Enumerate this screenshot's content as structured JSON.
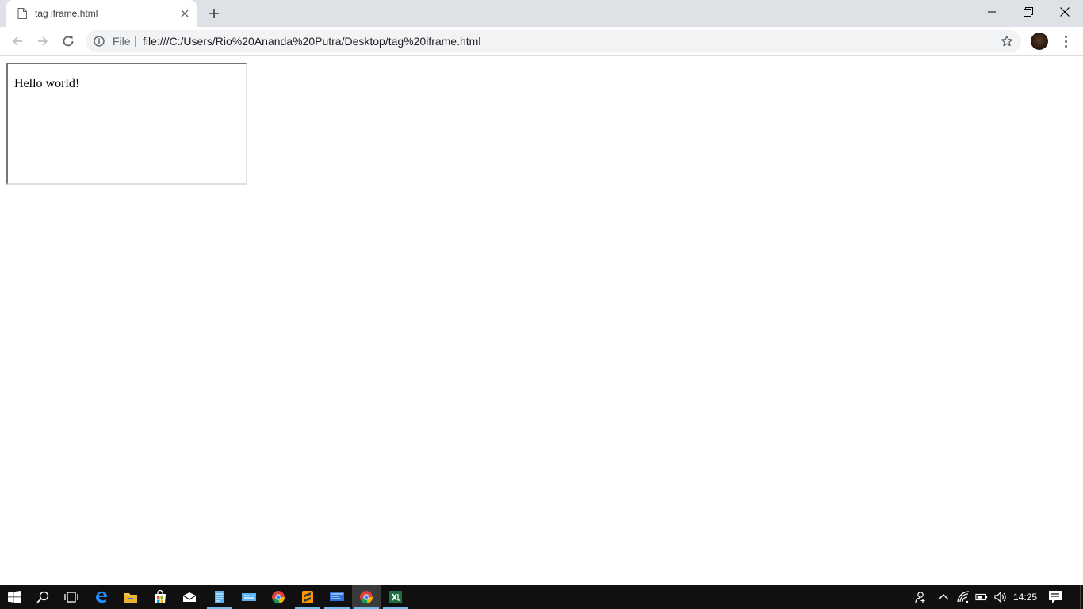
{
  "browser": {
    "tab": {
      "title": "tag iframe.html"
    },
    "omnibox": {
      "scheme_label": "File",
      "url": "file:///C:/Users/Rio%20Ananda%20Putra/Desktop/tag%20iframe.html"
    }
  },
  "page": {
    "iframe_text": "Hello world!"
  },
  "taskbar": {
    "apps": [
      "start-icon",
      "search-icon",
      "task-view-icon",
      "edge-icon",
      "file-explorer-icon",
      "store-icon",
      "mail-icon",
      "notepad-icon",
      "keyboard-icon",
      "chrome-icon",
      "sublime-text-icon",
      "app-icon",
      "chrome-icon",
      "excel-icon"
    ],
    "clock": "14:25"
  },
  "colors": {
    "tabstrip_bg": "#dee1e6",
    "omnibox_bg": "#f1f3f4",
    "taskbar_bg": "#101010",
    "taskbar_active_indicator": "#76b9ed"
  }
}
